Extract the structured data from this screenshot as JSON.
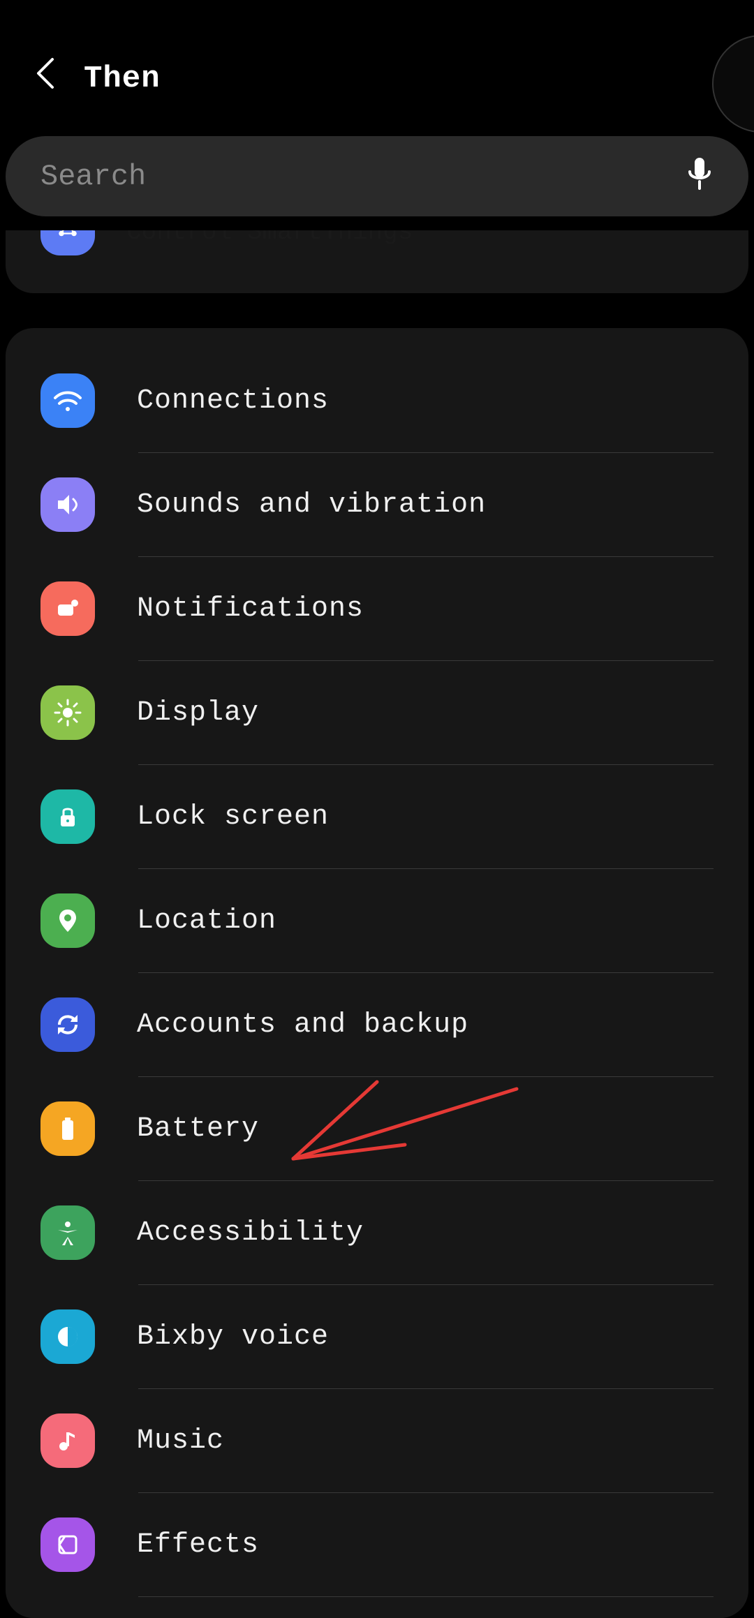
{
  "header": {
    "title": "Then"
  },
  "search": {
    "placeholder": "Search"
  },
  "partial": {
    "label": "Control SmartThings",
    "icon_color": "#5d7bf4"
  },
  "items": [
    {
      "label": "Connections",
      "icon_color": "#3b82f6",
      "icon": "wifi"
    },
    {
      "label": "Sounds and vibration",
      "icon_color": "#8b7ff5",
      "icon": "sound"
    },
    {
      "label": "Notifications",
      "icon_color": "#f66b5d",
      "icon": "notif"
    },
    {
      "label": "Display",
      "icon_color": "#8bc34a",
      "icon": "brightness"
    },
    {
      "label": "Lock screen",
      "icon_color": "#1eb8a6",
      "icon": "lock"
    },
    {
      "label": "Location",
      "icon_color": "#4caf50",
      "icon": "location"
    },
    {
      "label": "Accounts and backup",
      "icon_color": "#3b5bdb",
      "icon": "sync"
    },
    {
      "label": "Battery",
      "icon_color": "#f5a623",
      "icon": "battery"
    },
    {
      "label": "Accessibility",
      "icon_color": "#3da35d",
      "icon": "person"
    },
    {
      "label": "Bixby voice",
      "icon_color": "#1ba8d4",
      "icon": "bixby"
    },
    {
      "label": "Music",
      "icon_color": "#f56b7a",
      "icon": "music"
    },
    {
      "label": "Effects",
      "icon_color": "#a555e8",
      "icon": "effects"
    }
  ],
  "annotation": {
    "color": "#e53935"
  }
}
